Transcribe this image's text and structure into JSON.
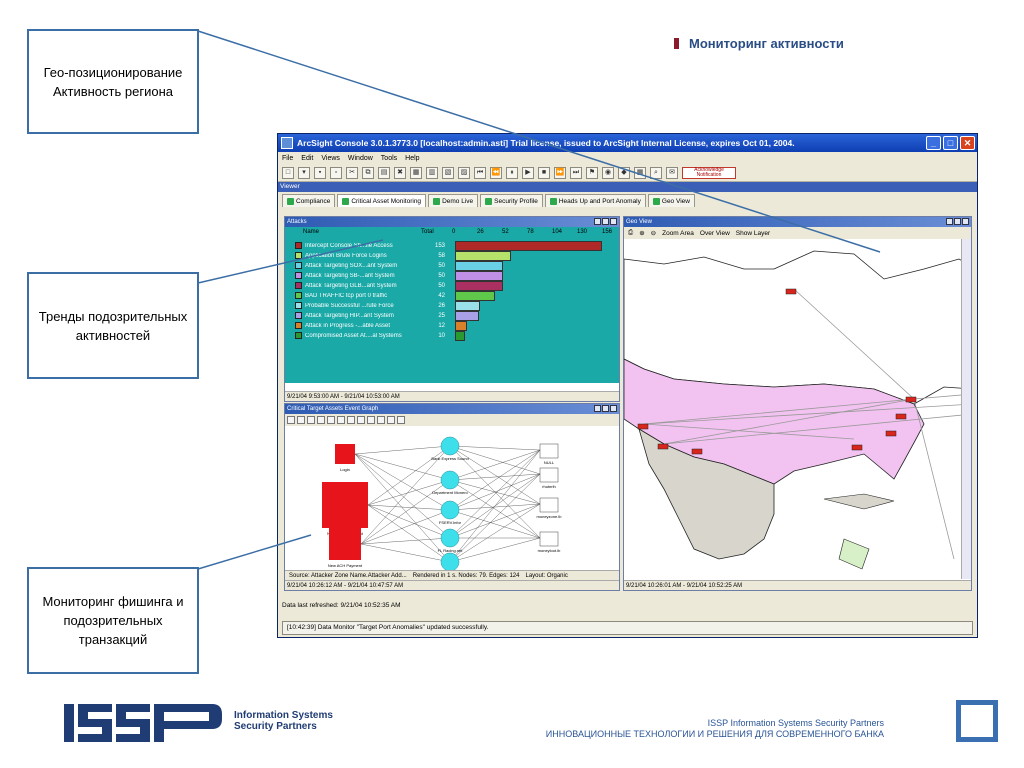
{
  "slide": {
    "title": "Мониторинг активности",
    "callouts": {
      "geo": "Гео-позиционирование Активность региона",
      "trends": "Тренды подозрительных активностей",
      "phishing": "Мониторинг фишинга и подозрительных транзакций"
    }
  },
  "window": {
    "title": "ArcSight Console 3.0.1.3773.0 [localhost:admin.asti] Trial license, issued to ArcSight Internal License, expires Oct 01, 2004.",
    "menu": [
      "File",
      "Edit",
      "Views",
      "Window",
      "Tools",
      "Help"
    ],
    "ack_label": "Acknowledge Notification",
    "viewer_label": "Viewer",
    "tabs": [
      "Compliance",
      "Critical Asset Monitoring",
      "Demo Live",
      "Security Profile",
      "Heads Up and Port Anomaly",
      "Geo View"
    ],
    "active_tab": "Critical Asset Monitoring"
  },
  "attacks": {
    "title": "Attacks",
    "col_name": "Name",
    "col_total": "Total",
    "axis_ticks": [
      "0",
      "26",
      "52",
      "78",
      "104",
      "130",
      "156"
    ],
    "rows": [
      {
        "name": "Intercept Console Sh...ile Access",
        "total": 153,
        "color": "#b02929"
      },
      {
        "name": "Application Brute Force Logins",
        "total": 58,
        "color": "#b5e06a"
      },
      {
        "name": "Attack Targeting SOX...ant System",
        "total": 50,
        "color": "#6ad0e6"
      },
      {
        "name": "Attack Targeting SB-...ant System",
        "total": 50,
        "color": "#c08fe6"
      },
      {
        "name": "Attack Targeting GLB...ant System",
        "total": 50,
        "color": "#a93060"
      },
      {
        "name": "BAD TRAFFIC tcp port 0 traffic",
        "total": 42,
        "color": "#5fc84a"
      },
      {
        "name": "Probable Successful ...rute Force",
        "total": 26,
        "color": "#9ae0e8"
      },
      {
        "name": "Attack Targeting HIP...ant System",
        "total": 25,
        "color": "#a9a0e8"
      },
      {
        "name": "Attack in Progress -...able Asset",
        "total": 12,
        "color": "#d9802a"
      },
      {
        "name": "Compromised Asset At....al Systems",
        "total": 10,
        "color": "#2a9a30"
      }
    ],
    "time_range": "9/21/04 9:53:00 AM - 9/21/04 10:53:00 AM"
  },
  "graph": {
    "title": "Critical Target Assets Event Graph",
    "left_nodes": [
      "Login",
      "New Payee Created",
      "New ACH Payment"
    ],
    "mid_nodes": [
      "Bank Express Sound",
      "Department Monero",
      "FSERV.Infor",
      "FL Racing.net",
      "Bio Corp.richards"
    ],
    "right_nodes": [
      "NULL",
      "rhuterlh",
      "moneyzone.lb",
      "moneyloot.lb"
    ],
    "status": [
      "Source: Attacker Zone Name.Attacker Add...",
      "Rendered in 1 s. Nodes: 79. Edges: 124",
      "Layout: Organic"
    ],
    "time_range": "9/21/04 10:26:12 AM - 9/21/04 10:47:57 AM"
  },
  "geo": {
    "title": "Geo View",
    "tools": [
      "Zoom Area",
      "Over View",
      "Show Layer"
    ],
    "time_range": "9/21/04 10:26:01 AM - 9/21/04 10:52:25 AM"
  },
  "refresh": "Data last refreshed: 9/21/04 10:52:35 AM",
  "status": "[10:42:39] Data Monitor \"Target Port Anomalies\" updated successfully.",
  "footer": {
    "logo_text_1": "Information Systems",
    "logo_text_2": "Security Partners",
    "line1": "ISSP Information Systems Security Partners",
    "line2": "ИННОВАЦИОННЫЕ ТЕХНОЛОГИИ И РЕШЕНИЯ ДЛЯ СОВРЕМЕННОГО БАНКА"
  },
  "colors": {
    "accent": "#2a4d86",
    "callout_border": "#3c6ea6",
    "bullet": "#8b1a2b",
    "attacks_bg": "#1aa9a7",
    "map_land": "#f2c3f0"
  }
}
